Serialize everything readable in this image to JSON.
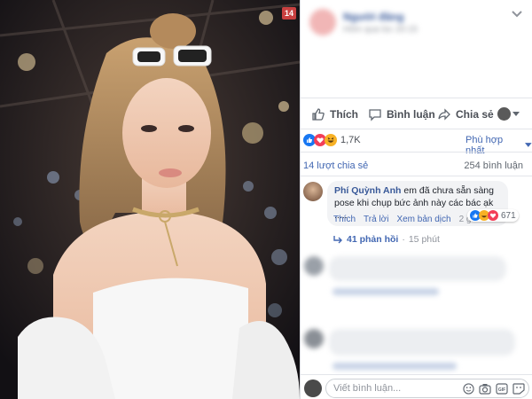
{
  "photo": {
    "badge": "14"
  },
  "post": {
    "author_blurred": "Người đăng",
    "time_blurred": "Hôm qua lúc 20:15",
    "actions": {
      "like": "Thích",
      "comment": "Bình luận",
      "share": "Chia sẻ"
    }
  },
  "reactions": {
    "count": "1,7K",
    "sort_label": "Phù hợp nhất",
    "shares": "14 lượt chia sẻ",
    "comments_count": "254 bình luận"
  },
  "comment": {
    "author": "Phí Quỳnh Anh",
    "text": "em đã chưa sẵn sàng pose khi chụp bức ảnh này các bác ạk .....",
    "actions": {
      "like": "Thích",
      "reply": "Trả lời",
      "translate": "Xem bản dịch",
      "time": "2 giờ"
    },
    "reaction_count": "671",
    "replies_label": "41 phản hồi",
    "replies_time": "15 phút"
  },
  "composer": {
    "placeholder": "Viết bình luận..."
  },
  "colors": {
    "facebook_blue": "#4267b2",
    "like_blue": "#1877f2",
    "love_red": "#f33e58",
    "haha_yellow": "#f7b125"
  }
}
